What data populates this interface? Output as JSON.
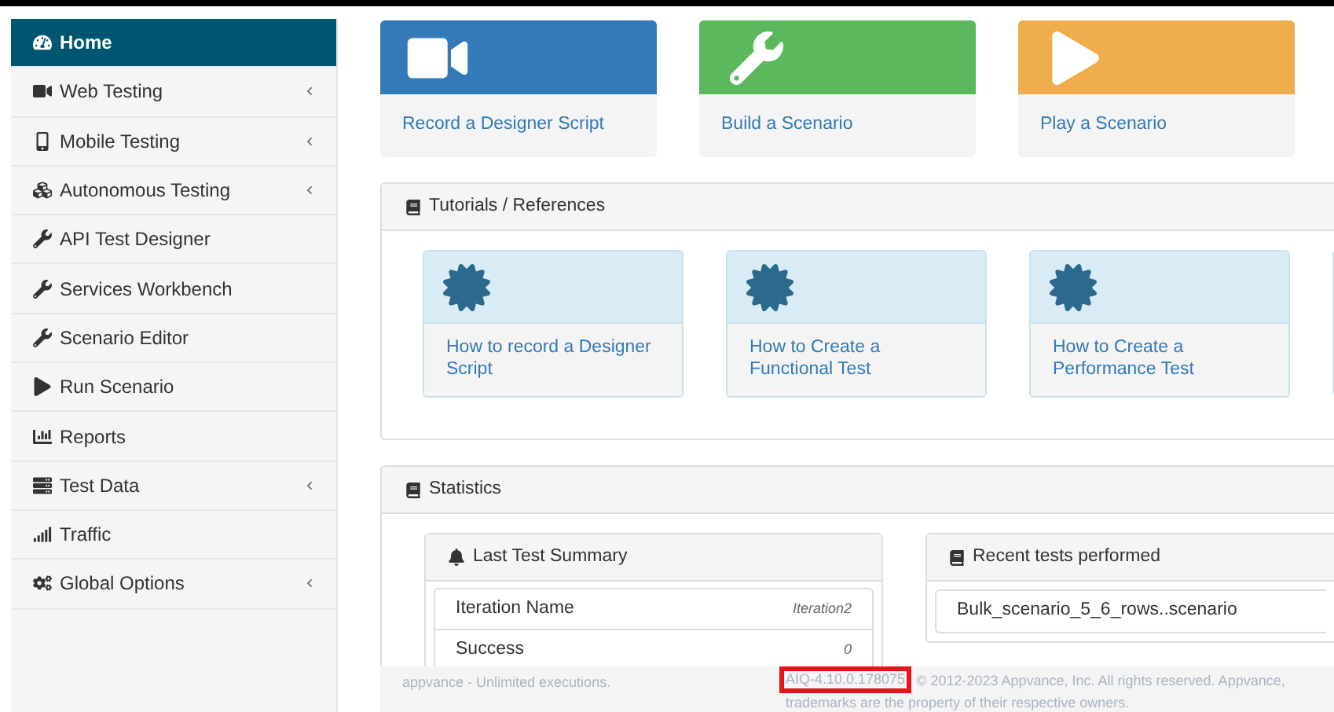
{
  "sidebar": {
    "items": [
      {
        "label": "Home",
        "selected": true,
        "has_submenu": false
      },
      {
        "label": "Web Testing",
        "selected": false,
        "has_submenu": true
      },
      {
        "label": "Mobile Testing",
        "selected": false,
        "has_submenu": true
      },
      {
        "label": "Autonomous Testing",
        "selected": false,
        "has_submenu": true
      },
      {
        "label": "API Test Designer",
        "selected": false,
        "has_submenu": false
      },
      {
        "label": "Services Workbench",
        "selected": false,
        "has_submenu": false
      },
      {
        "label": "Scenario Editor",
        "selected": false,
        "has_submenu": false
      },
      {
        "label": "Run Scenario",
        "selected": false,
        "has_submenu": false
      },
      {
        "label": "Reports",
        "selected": false,
        "has_submenu": false
      },
      {
        "label": "Test Data",
        "selected": false,
        "has_submenu": true
      },
      {
        "label": "Traffic",
        "selected": false,
        "has_submenu": false
      },
      {
        "label": "Global Options",
        "selected": false,
        "has_submenu": true
      }
    ]
  },
  "quick_actions": [
    {
      "label": "Record a Designer Script",
      "color": "#337ab7"
    },
    {
      "label": "Build a Scenario",
      "color": "#5cb85c"
    },
    {
      "label": "Play a Scenario",
      "color": "#f0ad4e"
    }
  ],
  "tutorials": {
    "title": "Tutorials / References",
    "cards": [
      {
        "label": "How to record a Designer Script"
      },
      {
        "label": "How to Create a Functional Test"
      },
      {
        "label": "How to Create a Performance Test"
      }
    ]
  },
  "statistics": {
    "title": "Statistics",
    "last_test_summary": {
      "title": "Last Test Summary",
      "rows": [
        {
          "name": "Iteration Name",
          "value": "Iteration2"
        },
        {
          "name": "Success",
          "value": "0"
        }
      ]
    },
    "recent_tests": {
      "title": "Recent tests performed",
      "items": [
        "Bulk_scenario_5_6_rows..scenario"
      ]
    }
  },
  "footer": {
    "license": "appvance - Unlimited executions.",
    "version": "AIQ-4.10.0.178075",
    "copyright": "© 2012-2023 Appvance, Inc. All rights reserved. Appvance,",
    "copyright_line_2": "trademarks are the property of their respective owners."
  }
}
